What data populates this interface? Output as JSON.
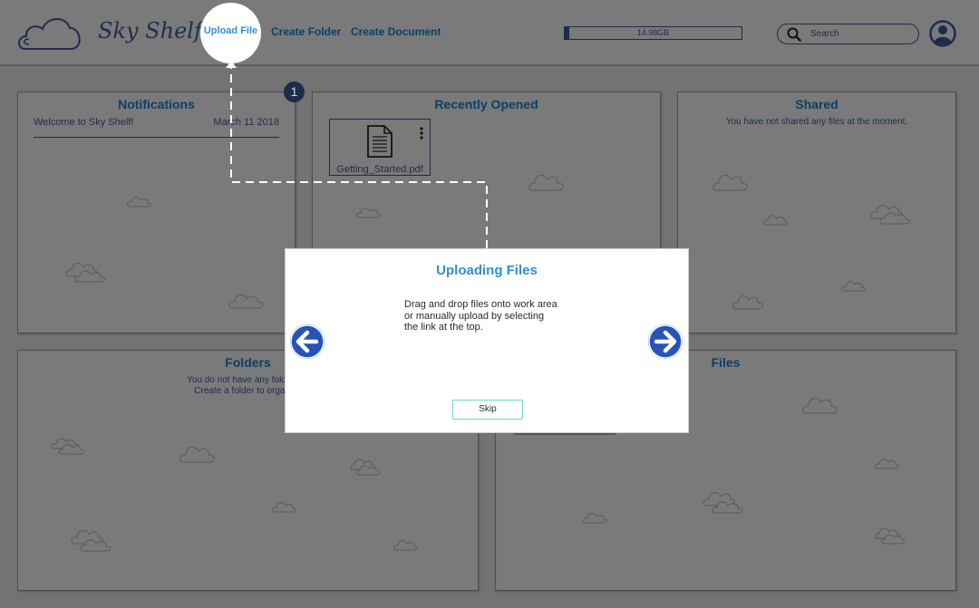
{
  "app": {
    "name": "Sky Shelf"
  },
  "nav": {
    "upload_file": "Upload File",
    "create_folder": "Create Folder",
    "create_document": "Create Document"
  },
  "storage": {
    "label": "14.98GB",
    "fill_fraction": 0.03
  },
  "search": {
    "placeholder": "Search"
  },
  "icons": {
    "logo": "cloud-logo-icon",
    "search": "search-icon",
    "avatar": "user-avatar-icon",
    "document": "document-icon",
    "more": "kebab-menu-icon",
    "prev": "arrow-left-icon",
    "next": "arrow-right-icon"
  },
  "panels": {
    "notifications": {
      "title": "Notifications",
      "items": [
        {
          "text": "Welcome to Sky Shelf!",
          "date": "March 11 2018"
        }
      ]
    },
    "recent": {
      "title": "Recently Opened",
      "files": [
        {
          "name": "Getting_Started.pdf"
        }
      ]
    },
    "shared": {
      "title": "Shared",
      "message": "You have not shared any files at the moment."
    },
    "folders": {
      "title": "Folders",
      "message_line1": "You do not have any folders at",
      "message_line2": "Create a folder to organize"
    },
    "files": {
      "title": "Files"
    }
  },
  "tutorial": {
    "step": "1",
    "title": "Uploading Files",
    "body_lines": [
      "Drag and drop files onto work area",
      "or manually upload by selecting",
      "the link at the top."
    ],
    "skip_label": "Skip"
  },
  "colors": {
    "overlay_bg": "#737373",
    "title_blue": "#0d3f63",
    "accent_blue": "#2f8fd8",
    "arrow_blue": "#2753b8",
    "skip_border": "#6ad2c8",
    "navy": "#1e2b4a"
  }
}
